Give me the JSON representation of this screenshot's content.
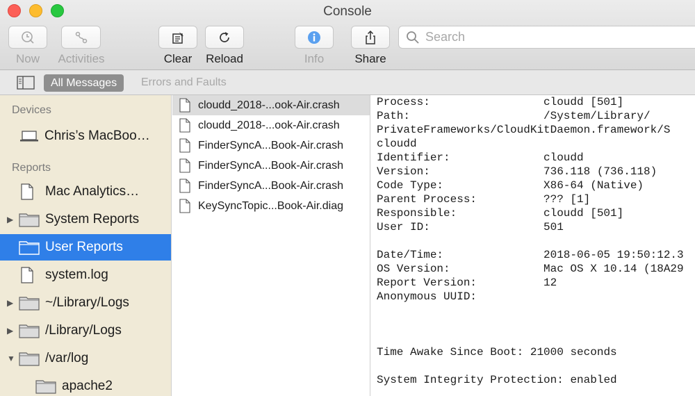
{
  "window": {
    "title": "Console"
  },
  "toolbar": {
    "now": "Now",
    "activities": "Activities",
    "clear": "Clear",
    "reload": "Reload",
    "info": "Info",
    "share": "Share",
    "search_placeholder": "Search"
  },
  "filters": {
    "all_messages": "All Messages",
    "errors_and_faults": "Errors and Faults"
  },
  "sidebar": {
    "devices_header": "Devices",
    "device": "Chris’s MacBoo…",
    "reports_header": "Reports",
    "items": [
      {
        "label": "Mac Analytics…"
      },
      {
        "label": "System Reports"
      },
      {
        "label": "User Reports"
      },
      {
        "label": "system.log"
      },
      {
        "label": "~/Library/Logs"
      },
      {
        "label": "/Library/Logs"
      },
      {
        "label": "/var/log"
      },
      {
        "label": "apache2"
      }
    ]
  },
  "files": [
    "cloudd_2018-...ook-Air.crash",
    "cloudd_2018-...ook-Air.crash",
    "FinderSyncA...Book-Air.crash",
    "FinderSyncA...Book-Air.crash",
    "FinderSyncA...Book-Air.crash",
    "KeySyncTopic...Book-Air.diag"
  ],
  "report": {
    "process_key": "Process:",
    "process_val": "cloudd [501]",
    "path_key": "Path:",
    "path_val": "/System/Library/",
    "path_cont1": "PrivateFrameworks/CloudKitDaemon.framework/S",
    "path_cont2": "cloudd",
    "identifier_key": "Identifier:",
    "identifier_val": "cloudd",
    "version_key": "Version:",
    "version_val": "736.118 (736.118)",
    "codetype_key": "Code Type:",
    "codetype_val": "X86-64 (Native)",
    "parent_key": "Parent Process:",
    "parent_val": "??? [1]",
    "responsible_key": "Responsible:",
    "responsible_val": "cloudd [501]",
    "userid_key": "User ID:",
    "userid_val": "501",
    "datetime_key": "Date/Time:",
    "datetime_val": "2018-06-05 19:50:12.3",
    "osversion_key": "OS Version:",
    "osversion_val": "Mac OS X 10.14 (18A29",
    "reportversion_key": "Report Version:",
    "reportversion_val": "12",
    "uuid_key": "Anonymous UUID:",
    "awake": "Time Awake Since Boot: 21000 seconds",
    "sip": "System Integrity Protection: enabled"
  }
}
